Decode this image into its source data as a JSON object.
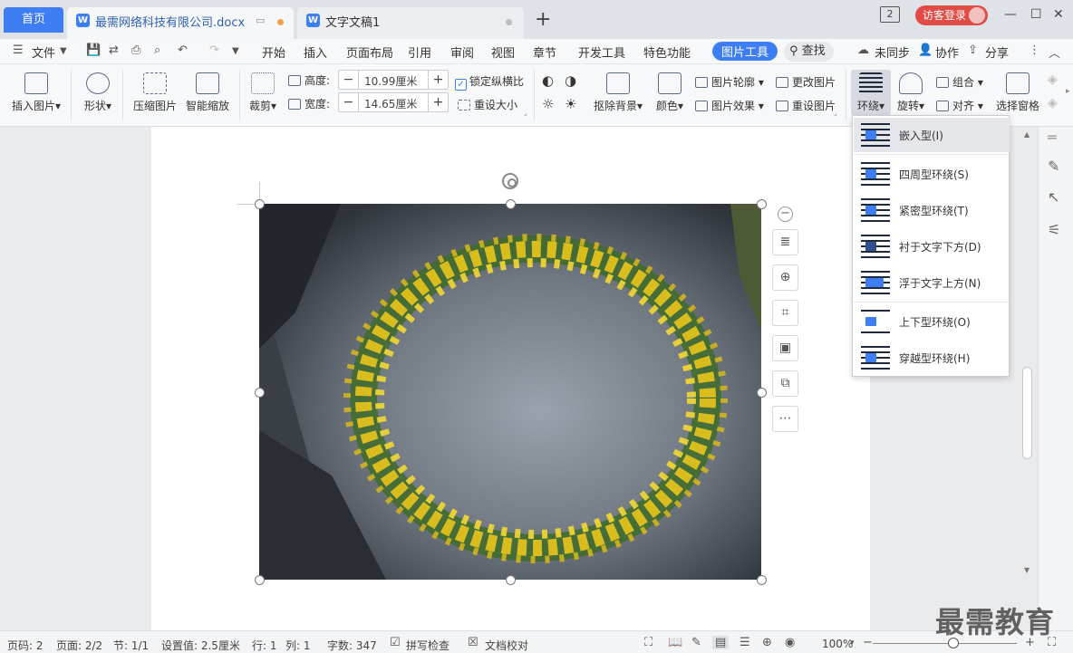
{
  "tabs": {
    "home": "首页",
    "doc1": "最需网络科技有限公司.docx",
    "doc2": "文字文稿1",
    "badge": "2",
    "login": "访客登录"
  },
  "menu": {
    "file": "文件",
    "items": [
      "开始",
      "插入",
      "页面布局",
      "引用",
      "审阅",
      "视图",
      "章节",
      "开发工具",
      "特色功能"
    ],
    "active": "图片工具",
    "search": "查找",
    "sync": "未同步",
    "collab": "协作",
    "share": "分享"
  },
  "ribbon": {
    "insert_image": "插入图片",
    "shape": "形状",
    "compress": "压缩图片",
    "smart_zoom": "智能缩放",
    "crop": "裁剪",
    "height_label": "高度:",
    "height_value": "10.99厘米",
    "width_label": "宽度:",
    "width_value": "14.65厘米",
    "lock_ratio": "锁定纵横比",
    "resize": "重设大小",
    "remove_bg": "抠除背景",
    "color": "颜色",
    "outline": "图片轮廓",
    "effect": "图片效果",
    "change_image": "更改图片",
    "reset_image": "重设图片",
    "wrap": "环绕",
    "rotate": "旋转",
    "group": "组合",
    "align": "对齐",
    "select_pane": "选择窗格"
  },
  "wrap_menu": {
    "items": [
      "嵌入型(I)",
      "四周型环绕(S)",
      "紧密型环绕(T)",
      "衬于文字下方(D)",
      "浮于文字上方(N)",
      "上下型环绕(O)",
      "穿越型环绕(H)"
    ],
    "selected_index": 0
  },
  "status": {
    "page": "页码: 2",
    "pages": "页面: 2/2",
    "section": "节: 1/1",
    "setting": "设置值: 2.5厘米",
    "row": "行: 1",
    "col": "列: 1",
    "words": "字数: 347",
    "spell": "拼写检查",
    "proof": "文档校对",
    "zoom": "100%"
  },
  "watermark": "最需教育",
  "colors": {
    "accent": "#3d7ef5",
    "login_bg": "#e04b45"
  }
}
